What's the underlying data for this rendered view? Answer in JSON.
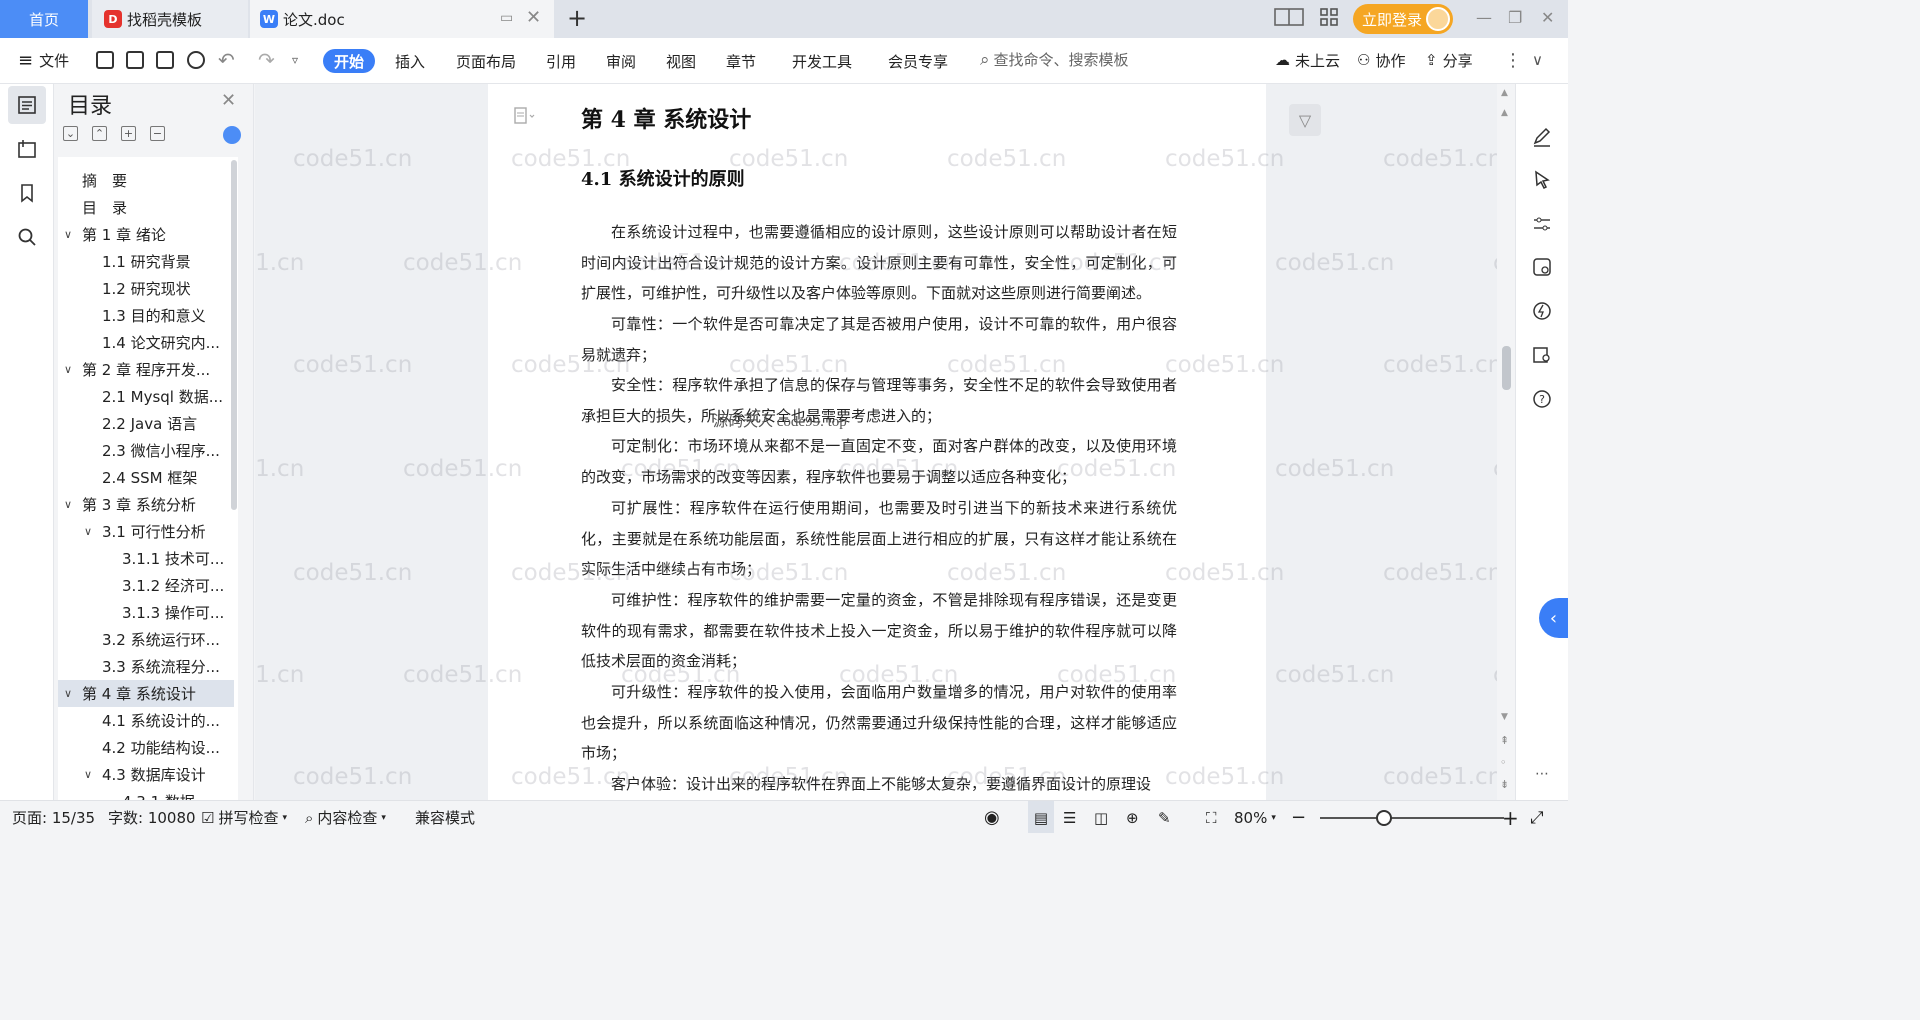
{
  "tabs": {
    "home": "首页",
    "template": "找稻壳模板",
    "doc": "论文.doc",
    "login": "立即登录"
  },
  "toolbar": {
    "file": "文件",
    "menus": [
      "开始",
      "插入",
      "页面布局",
      "引用",
      "审阅",
      "视图",
      "章节",
      "开发工具",
      "会员专享"
    ],
    "search_placeholder": "查找命令、搜索模板",
    "cloud": "未上云",
    "collab": "协作",
    "share": "分享"
  },
  "toc": {
    "title": "目录",
    "items": [
      {
        "label": "摘　要",
        "level": 0,
        "chev": ""
      },
      {
        "label": "目　录",
        "level": 0,
        "chev": ""
      },
      {
        "label": "第 1 章  绪论",
        "level": 0,
        "chev": "v"
      },
      {
        "label": "1.1 研究背景",
        "level": 1,
        "chev": ""
      },
      {
        "label": "1.2 研究现状",
        "level": 1,
        "chev": ""
      },
      {
        "label": "1.3 目的和意义",
        "level": 1,
        "chev": ""
      },
      {
        "label": "1.4 论文研究内...",
        "level": 1,
        "chev": ""
      },
      {
        "label": "第 2 章  程序开发...",
        "level": 0,
        "chev": "v"
      },
      {
        "label": "2.1 Mysql 数据...",
        "level": 1,
        "chev": ""
      },
      {
        "label": "2.2 Java 语言",
        "level": 1,
        "chev": ""
      },
      {
        "label": "2.3 微信小程序...",
        "level": 1,
        "chev": ""
      },
      {
        "label": "2.4 SSM 框架",
        "level": 1,
        "chev": ""
      },
      {
        "label": "第 3 章  系统分析",
        "level": 0,
        "chev": "v"
      },
      {
        "label": "3.1 可行性分析",
        "level": 1,
        "chev": "v"
      },
      {
        "label": "3.1.1 技术可...",
        "level": 2,
        "chev": ""
      },
      {
        "label": "3.1.2 经济可...",
        "level": 2,
        "chev": ""
      },
      {
        "label": "3.1.3 操作可...",
        "level": 2,
        "chev": ""
      },
      {
        "label": "3.2 系统运行环...",
        "level": 1,
        "chev": ""
      },
      {
        "label": "3.3 系统流程分...",
        "level": 1,
        "chev": ""
      },
      {
        "label": "第 4 章  系统设计",
        "level": 0,
        "chev": "v"
      },
      {
        "label": "4.1  系统设计的...",
        "level": 1,
        "chev": ""
      },
      {
        "label": "4.2  功能结构设...",
        "level": 1,
        "chev": ""
      },
      {
        "label": "4.3  数据库设计",
        "level": 1,
        "chev": "v"
      },
      {
        "label": "4.3.1  数据...",
        "level": 2,
        "chev": ""
      }
    ],
    "selected_index": 19
  },
  "document": {
    "chapter": "第 4 章  系统设计",
    "section": "4.1  系统设计的原则",
    "paragraphs": [
      "在系统设计过程中，也需要遵循相应的设计原则，这些设计原则可以帮助设计者在短时间内设计出符合设计规范的设计方案。设计原则主要有可靠性，安全性，可定制化，可扩展性，可维护性，可升级性以及客户体验等原则。下面就对这些原则进行简要阐述。",
      "可靠性：一个软件是否可靠决定了其是否被用户使用，设计不可靠的软件，用户很容易就遗弃；",
      "安全性：程序软件承担了信息的保存与管理等事务，安全性不足的软件会导致使用者承担巨大的损失，所以系统安全也是需要考虑进入的；",
      "可定制化：市场环境从来都不是一直固定不变，面对客户群体的改变，以及使用环境的改变，市场需求的改变等因素，程序软件也要易于调整以适应各种变化；",
      "可扩展性：程序软件在运行使用期间，也需要及时引进当下的新技术来进行系统优化，主要就是在系统功能层面，系统性能层面上进行相应的扩展，只有这样才能让系统在实际生活中继续占有市场；",
      "可维护性：程序软件的维护需要一定量的资金，不管是排除现有程序错误，还是变更软件的现有需求，都需要在软件技术上投入一定资金，所以易于维护的软件程序就可以降低技术层面的资金消耗；",
      "可升级性：程序软件的投入使用，会面临用户数量增多的情况，用户对软件的使用率也会提升，所以系统面临这种情况，仍然需要通过升级保持性能的合理，这样才能够适应市场；",
      "客户体验：设计出来的程序软件在界面上不能够太复杂，要遵循界面设计的原理设"
    ],
    "watermark": "code51.cn",
    "source_mark": "源码天人 code99. top"
  },
  "status": {
    "page": "页面: 15/35",
    "words": "字数: 10080",
    "spell": "拼写检查",
    "content_check": "内容检查",
    "compat": "兼容模式",
    "zoom": "80%"
  },
  "colors": {
    "accent": "#3a7ef7",
    "login": "#f5a623",
    "home_tab": "#4c8df6"
  }
}
